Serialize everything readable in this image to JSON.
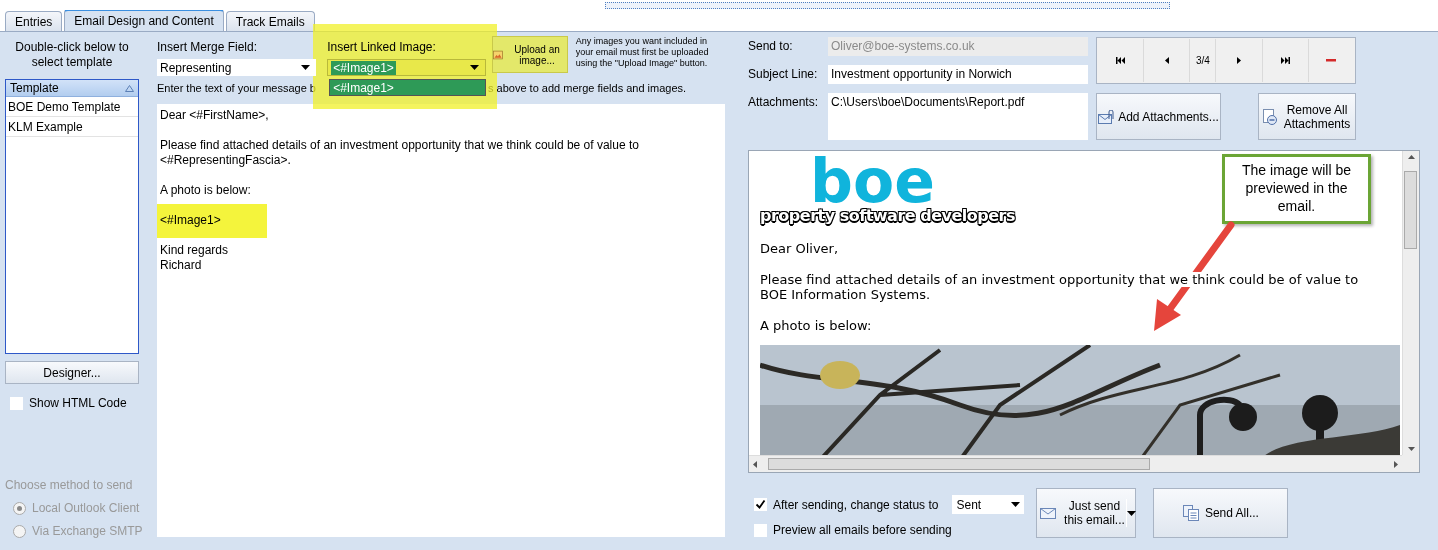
{
  "tabs": [
    {
      "label": "Entries",
      "selected": false
    },
    {
      "label": "Email Design and Content",
      "selected": true
    },
    {
      "label": "Track Emails",
      "selected": false
    }
  ],
  "template_panel": {
    "instruction": "Double-click below to select template",
    "list": {
      "column": "Template",
      "rows": [
        {
          "label": "BOE Demo Template",
          "selected": false
        },
        {
          "label": "KLM Example",
          "selected": false
        }
      ]
    },
    "designer_button": "Designer...",
    "show_html": {
      "label": "Show HTML Code",
      "checked": false
    },
    "send_method": {
      "title": "Choose method to send",
      "disabled": true,
      "options": [
        {
          "label": "Local Outlook Client",
          "selected": true
        },
        {
          "label": "Via Exchange SMTP",
          "selected": false
        }
      ]
    }
  },
  "merge_field": {
    "label": "Insert Merge Field:",
    "value": "Representing"
  },
  "linked_image": {
    "label": "Insert Linked Image:",
    "value": "<#Image1>",
    "dropdown_items": [
      "<#Image1>"
    ]
  },
  "upload_button": "Upload an image...",
  "upload_note": "Any images you want included in your email must first be uploaded using the \"Upload Image\" button.",
  "editor": {
    "hint_before": "Enter the text of your message b",
    "hint_after": "s above to add merge fields and images.",
    "paragraphs": [
      {
        "lines": [
          "Dear <#FirstName>,"
        ],
        "highlighted": false
      },
      {
        "lines": [
          "Please find attached details of an investment opportunity that we think could be of value to",
          "<#RepresentingFascia>."
        ],
        "highlighted": false
      },
      {
        "lines": [
          "A photo is below:"
        ],
        "highlighted": false
      },
      {
        "lines": [
          "<#Image1>"
        ],
        "highlighted": true
      },
      {
        "lines": [
          "Kind regards",
          "Richard"
        ],
        "highlighted": false
      }
    ]
  },
  "send_to": {
    "label": "Send to:",
    "value": "Oliver@boe-systems.co.uk",
    "disabled": true
  },
  "subject": {
    "label": "Subject Line:",
    "value": "Investment opportunity in Norwich"
  },
  "attachments": {
    "label": "Attachments:",
    "value": "C:\\Users\\boe\\Documents\\Report.pdf"
  },
  "navigator": {
    "position": "3/4"
  },
  "add_attachments_button": "Add Attachments...",
  "remove_attachments_button": "Remove All Attachments",
  "preview": {
    "logo": {
      "wordmark": "boe",
      "tagline": "property software developers"
    },
    "paragraphs": [
      "Dear Oliver,",
      "Please find attached details of an investment opportunity that we think could be of value to BOE Information Systems.",
      "A photo is below:"
    ]
  },
  "callout": "The image will be previewed in the email.",
  "after_sending": {
    "label": "After sending, change status to",
    "checked": true,
    "status": "Sent"
  },
  "preview_all": {
    "label": "Preview all emails before sending",
    "checked": false
  },
  "just_send_button": "Just send this email...",
  "send_all_button": "Send All..."
}
